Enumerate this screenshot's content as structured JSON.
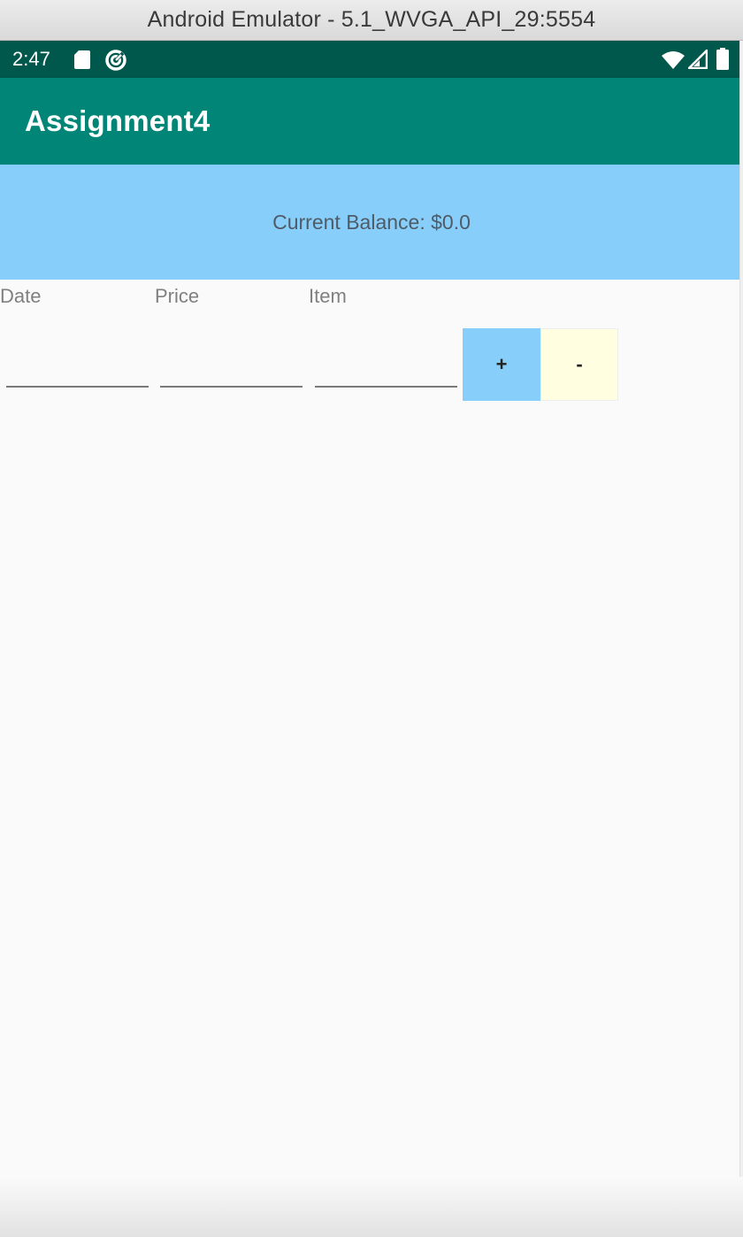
{
  "window": {
    "title": "Android Emulator - 5.1_WVGA_API_29:5554"
  },
  "status_bar": {
    "time": "2:47",
    "background": "#00574b",
    "icons": [
      "sd-card-icon",
      "sync-icon",
      "wifi-icon",
      "signal-icon",
      "battery-icon"
    ]
  },
  "app_bar": {
    "title": "Assignment4",
    "background": "#008577"
  },
  "balance": {
    "text": "Current Balance: $0.0",
    "background": "#87cefa"
  },
  "form": {
    "labels": {
      "date": "Date",
      "price": "Price",
      "item": "Item"
    },
    "fields": {
      "date": "",
      "price": "",
      "item": ""
    },
    "buttons": {
      "add_label": "+",
      "add_color": "#87cefa",
      "subtract_label": "-",
      "subtract_color": "#fffee0"
    }
  }
}
